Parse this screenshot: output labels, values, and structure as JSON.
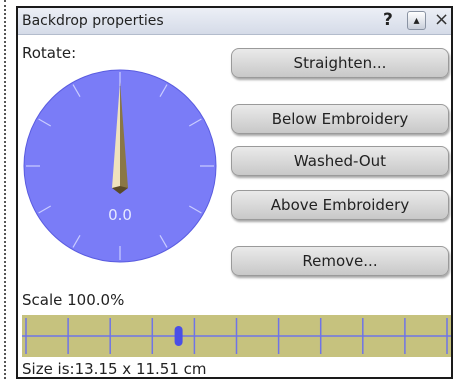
{
  "window": {
    "title": "Backdrop properties",
    "help_glyph": "?",
    "minimize_glyph": "▴",
    "close_glyph": "×"
  },
  "rotate": {
    "label": "Rotate:",
    "value_text": "0.0",
    "angle_degrees": 0
  },
  "buttons": {
    "straighten": "Straighten...",
    "below_embroidery": "Below Embroidery",
    "washed_out": "Washed-Out",
    "above_embroidery": "Above Embroidery",
    "remove": "Remove..."
  },
  "scale": {
    "label": "Scale 100.0%",
    "percent": 100.0
  },
  "size": {
    "label": "Size is:13.15 x 11.51 cm"
  },
  "colors": {
    "dial_fill": "#7a7cf7",
    "slider_track": "#c6c27e",
    "slider_lines": "#6f74e6",
    "slider_thumb": "#4a4fe6",
    "needle_light": "#efe2bd",
    "needle_dark": "#8a7745"
  },
  "icons": {
    "help": "help-icon",
    "minimize": "minimize-icon",
    "close": "close-icon"
  }
}
